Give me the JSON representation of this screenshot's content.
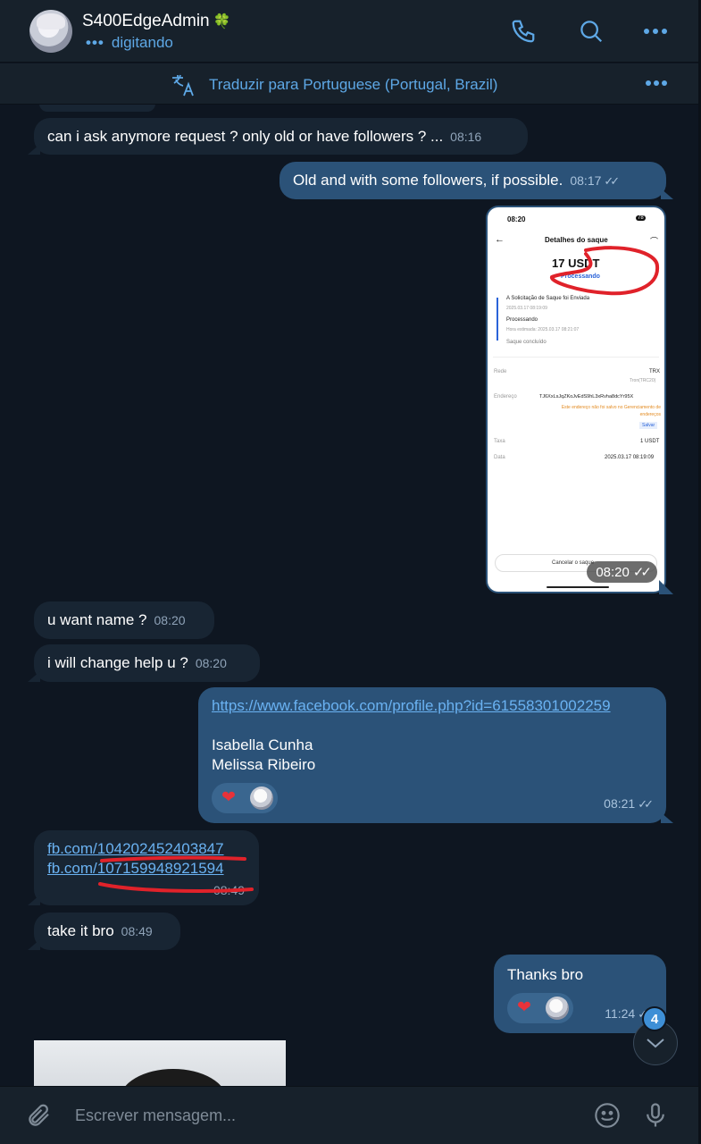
{
  "header": {
    "title": "S400EdgeAdmin",
    "status": "digitando",
    "emoji": "🍀"
  },
  "translate": {
    "label": "Traduzir para Portuguese (Portugal, Brazil)"
  },
  "messages": [
    {
      "id": "m1",
      "dir": "in",
      "text": "can i ask anymore request ? only old or have followers ? ...",
      "time": "08:16"
    },
    {
      "id": "m2",
      "dir": "out",
      "text": "Old and with some followers, if possible.",
      "time": "08:17"
    },
    {
      "id": "m3",
      "dir": "out",
      "type": "image",
      "time": "08:20"
    },
    {
      "id": "m4",
      "dir": "in",
      "text": "u want name ?",
      "time": "08:20"
    },
    {
      "id": "m5",
      "dir": "in",
      "text": "i will change help u ?",
      "time": "08:20"
    },
    {
      "id": "m6",
      "dir": "out",
      "link": "https://www.facebook.com/profile.php?id=61558301002259",
      "line1": "Isabella Cunha",
      "line2": "Melissa Ribeiro",
      "time": "08:21"
    },
    {
      "id": "m7",
      "dir": "in",
      "link1": "fb.com/104202452403847",
      "link2": "fb.com/107159948921594",
      "time": "08:49"
    },
    {
      "id": "m8",
      "dir": "in",
      "text": "take it bro",
      "time": "08:49"
    },
    {
      "id": "m9",
      "dir": "out",
      "text": "Thanks bro",
      "time": "11:24"
    }
  ],
  "screenshot": {
    "status_time": "08:20",
    "battery": "78",
    "title": "Detalhes do saque",
    "amount": "17 USDT",
    "state": "Processando",
    "step1": "A Solicitação de Saque foi Enviada",
    "step1_date": "2025.03.17 08:19:09",
    "step2": "Processando",
    "step2_date": "Hora estimada: 2025.03.17 08:21:07",
    "step3": "Saque concluído",
    "rede_label": "Rede",
    "rede_value": "TRX",
    "rede_sub": "Tron(TRC20)",
    "end_label": "Endereço",
    "end_value": "TJ6XxLsJqZKoJvEdS9hL3xRvha8dcYr95X",
    "end_warn": "Este endereço não foi salvo no Gerenciamento de endereços",
    "save": "Salvar",
    "taxa_label": "Taxa",
    "taxa_value": "1 USDT",
    "data_label": "Data",
    "data_value": "2025.03.17 08:19:09",
    "cancel": "Cancelar o saque"
  },
  "unread_count": "4",
  "composer": {
    "placeholder": "Escrever mensagem..."
  },
  "colors": {
    "accent": "#5ea8e6",
    "incoming": "#182533",
    "outgoing": "#2b5278",
    "background": "#0e1621"
  }
}
